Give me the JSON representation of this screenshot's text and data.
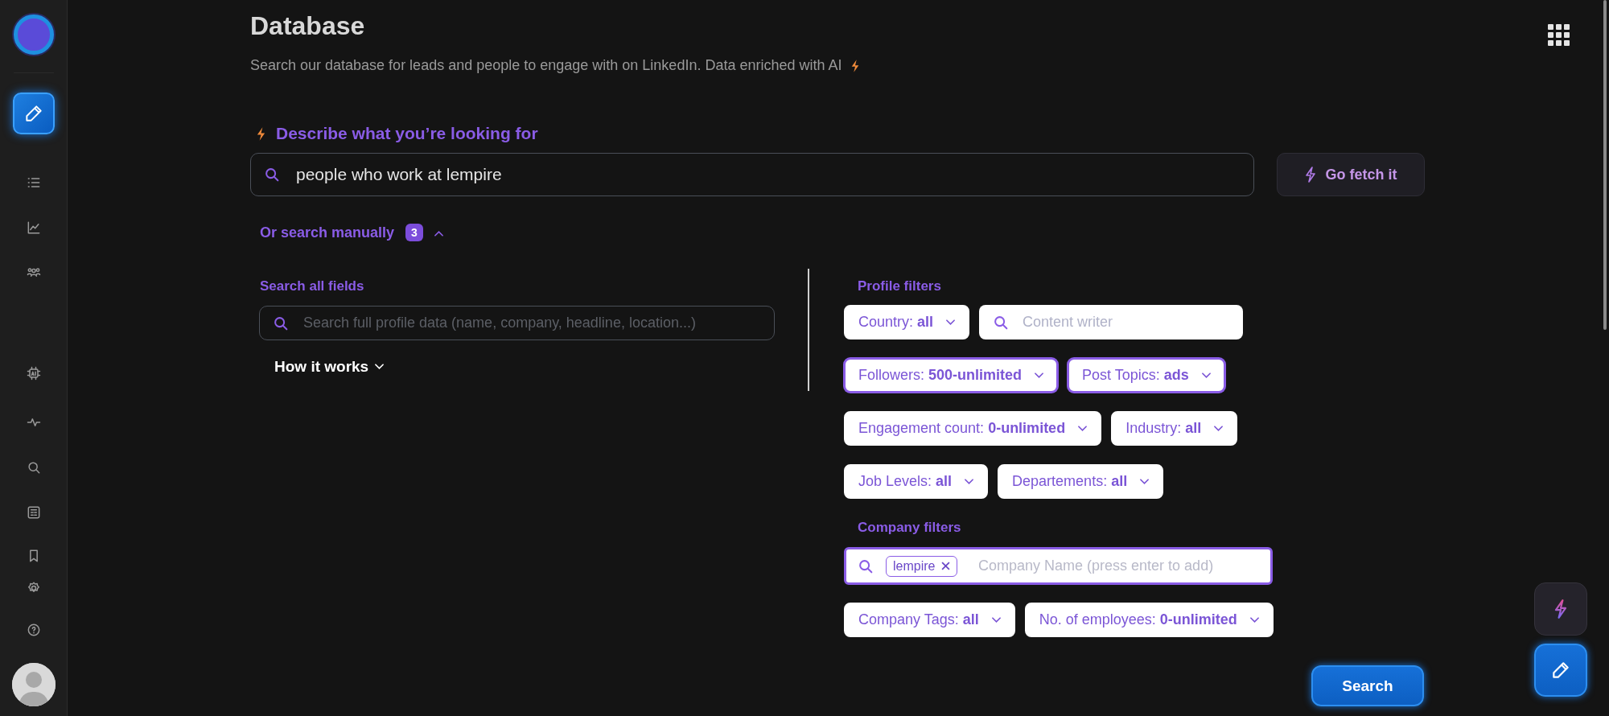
{
  "sidebar": {
    "items": [
      {
        "selected": true
      },
      {
        "selected": false
      },
      {
        "selected": false
      },
      {
        "selected": false
      },
      {
        "selected": false
      },
      {
        "selected": false
      },
      {
        "selected": false
      },
      {
        "selected": false
      },
      {
        "selected": false
      },
      {
        "selected": false
      },
      {
        "selected": false
      }
    ]
  },
  "header": {
    "title": "Database",
    "subtitle": "Search our database for leads and people to engage with on LinkedIn. Data enriched with AI"
  },
  "ai_search": {
    "label": "Describe what you’re looking for",
    "value": "people who work at lempire",
    "button": "Go fetch it"
  },
  "manual": {
    "label": "Or search manually",
    "count": "3",
    "expanded": true
  },
  "all_fields": {
    "label": "Search all fields",
    "placeholder": "Search full profile data (name, company, headline, location...)",
    "help": "How it works"
  },
  "profile_filters": {
    "label": "Profile filters",
    "rows": [
      [
        {
          "kind": "dropdown",
          "label": "Country:",
          "value": "all",
          "active": false
        },
        {
          "kind": "search",
          "placeholder": "Content writer"
        }
      ],
      [
        {
          "kind": "dropdown",
          "label": "Followers:",
          "value": "500-unlimited",
          "active": true
        },
        {
          "kind": "dropdown",
          "label": "Post Topics:",
          "value": "ads",
          "active": true
        }
      ],
      [
        {
          "kind": "dropdown",
          "label": "Engagement count:",
          "value": "0-unlimited",
          "active": false
        },
        {
          "kind": "dropdown",
          "label": "Industry:",
          "value": "all",
          "active": false
        }
      ],
      [
        {
          "kind": "dropdown",
          "label": "Job Levels:",
          "value": "all",
          "active": false
        },
        {
          "kind": "dropdown",
          "label": "Departements:",
          "value": "all",
          "active": false
        }
      ]
    ]
  },
  "company_filters": {
    "label": "Company filters",
    "tags": [
      "lempire"
    ],
    "placeholder": "Company Name (press enter to add)",
    "rows": [
      [
        {
          "kind": "dropdown",
          "label": "Company Tags:",
          "value": "all",
          "active": false
        },
        {
          "kind": "dropdown",
          "label": "No. of employees:",
          "value": "0-unlimited",
          "active": false
        }
      ]
    ]
  },
  "search_button": "Search"
}
